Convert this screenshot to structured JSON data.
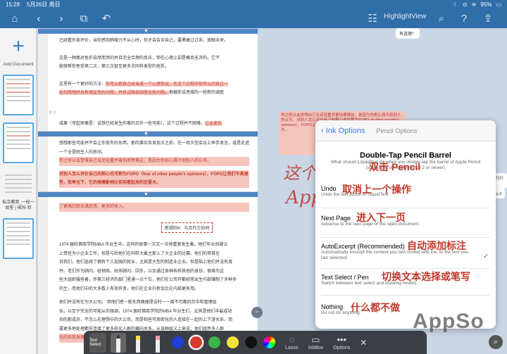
{
  "status": {
    "time": "15:28",
    "date": "5月26日 周日",
    "battery": "95%"
  },
  "toolbar": {
    "title": "HighlightView"
  },
  "sidebar": {
    "add_label": "Add Document",
    "doc_label": "私立教育_一校一如笙 | 埃玛·邓"
  },
  "reader": {
    "p1": [
      "已经看外部评价，当你感到稍微力不从心时，你才会告诉自己，要勇敢过过去，放眼未来。",
      "这是一种面对挫折自然而然的并且完全合理的反应，但在心理上却是概否无济的。它不",
      "能够帮你免受第二次、第三次甚至更多次同样类型的挫折。"
    ],
    "p2_plain": "这里有一个更好的方法：",
    "p2_hl1": "你可以把自己经当成一个心理协议，在这个过程中你可以问自己一",
    "p2_hl2": "系列简明并且有理定性的问题，并且试图去回答这些问题。",
    "p2_tail": "根据前设思维的一些新的调查",
    "pagemark": "P 2",
    "p3": "成果（可起来像是：设想已经发生的事的另外一些可能），这个过程并不困难。",
    "p3_hl": "它会使你",
    "p4": [
      "想想那些可能并不会让你丢失的东西，那的事实及发现点之前，在一场大型会议上举手发言，或是走进一个全是陌生人的房间。"
    ],
    "p4_hl": "你之所以会觉得自己无足轻重并害怕而畏惧这，是因为你担心得不到别人的认可。",
    "p5_hl": "对别人怎么评价自己的担心也可称为FOPO（fear of other people's opinions），FOPO让我们不具理性，效率也下，它的弹模影响比实际看起来的还要大。",
    "p6_tail": "了更高的职业满足感、更多的收入。",
    "heading": "新规则4：与合作方协同",
    "p7": [
      "1974 届哈佛商学院MBA 毕业生中，这样的故事一次又一次地重复发生着。他们毕业后被父",
      "上责任为小企业工作，但是与后他们在同样大雇主那入了大企业的比赛。他们的项目在",
      "诉我们，他们选择了拥有个三加强的就业，尤其是大型的制造业企业。但是陷上他们并没有真",
      "并。老们作为顾问、经销商、财务顾问、因东，以及通过各种各样其他的身份。很难为这",
      "些大组织服务着，作第三经济的部门里通一点个位，他们在公司开都经常出生内部赚制了多种多",
      "的生，而他们中的大多数人有效有变，他们在企业升新会比在内部更有用。"
    ],
    "p8": [
      "他们并没有在为大公司。   但他们把一般东西随便提设时一一离不可都的存中和管理层",
      "似，以至于完全的可能从的强调，1974 届哈佛商学院的MBA 毕业生们，尤其是他们中最成功",
      "功的那成员，不怎么在理想中的大公司，而是和些可周密化的人连接在一起的上下游关系，而",
      "要更多地处理都市连接了更多样化人群的横向关系。从该种层义上来说，他们组件多人群"
    ],
    "p8_hl": "化的自我发展"
  },
  "canvas": {
    "note_top": "有道理！",
    "note_pink": "你之所以会觉得自己无足轻重并害怕畏惧这，是因为你担心得不到别人的认可，对别人怎么评价自己的担心也可称为FOPO of other people's opinions），FOPO让我们不具理性，效率也下，比实际看起来的还要大。",
    "note_side1": "行行行行好",
    "note_side2": "，p.3",
    "hand1": "这个",
    "hand2": "AppS"
  },
  "options": {
    "back_label": "Ink Options",
    "sub_label": "Pencil Options",
    "title": "Double-Tap Pencil Barrel",
    "desc": "What should LiquidText do when you double-tap the barrel of Apple Pencil (supported on Apple Pencil 2 or newer)",
    "title_cn": "双击 Pencil",
    "rows": [
      {
        "title": "Undo",
        "desc": "Undo the last action in LiquidText.",
        "cn": "取消上一个操作"
      },
      {
        "title": "Next Page",
        "desc": "Advance to the next page of the open document.",
        "cn": "进入下一页"
      },
      {
        "title": "AutoExcerpt (Recommended)",
        "desc": "Automatically excerpt the content you last circled with ink, or the text you last selected.",
        "cn": "自动添加标注",
        "checked": true
      },
      {
        "title": "Text Select / Pen",
        "desc": "Switch between text select and drawing modes.",
        "cn": "切换文本选择或笔写"
      },
      {
        "title": "Nothing",
        "desc": "Do not do anything.",
        "cn": "什么都不做"
      }
    ]
  },
  "tools": {
    "text_select": "Text Select",
    "lasso": "Lasso",
    "inkbox": "InkBox",
    "options": "Options",
    "colors": [
      "#1b3fd8",
      "#d83a2b",
      "#3bb54a",
      "#f4e23a",
      "#111111",
      "#8a4bd6"
    ],
    "selected_color": "#d83a2b"
  },
  "watermark": "AppSo"
}
